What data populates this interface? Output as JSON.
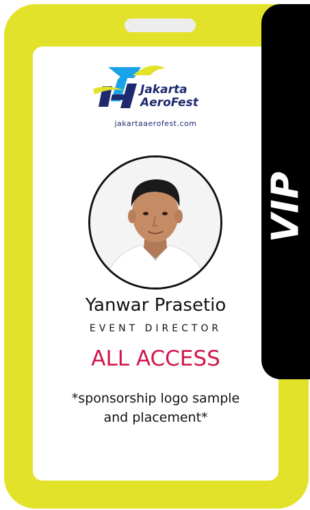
{
  "brand": {
    "name_line1": "Jakarta",
    "name_line2": "AeroFest",
    "url": "jakartaaerofest.com"
  },
  "badge": {
    "level": "VIP",
    "person_name": "Yanwar Prasetio",
    "person_title": "EVENT DIRECTOR",
    "access": "ALL ACCESS",
    "sponsor_line1": "*sponsorship logo sample",
    "sponsor_line2": "and placement*"
  },
  "colors": {
    "lanyard_yellow": "#e3e22b",
    "band_black": "#000000",
    "access_red": "#d0164a",
    "brand_navy": "#1e2a6e",
    "brand_blue": "#1aa3e8"
  },
  "icons": {
    "logo": "jakarta-aerofest-logo",
    "photo": "person-portrait"
  }
}
